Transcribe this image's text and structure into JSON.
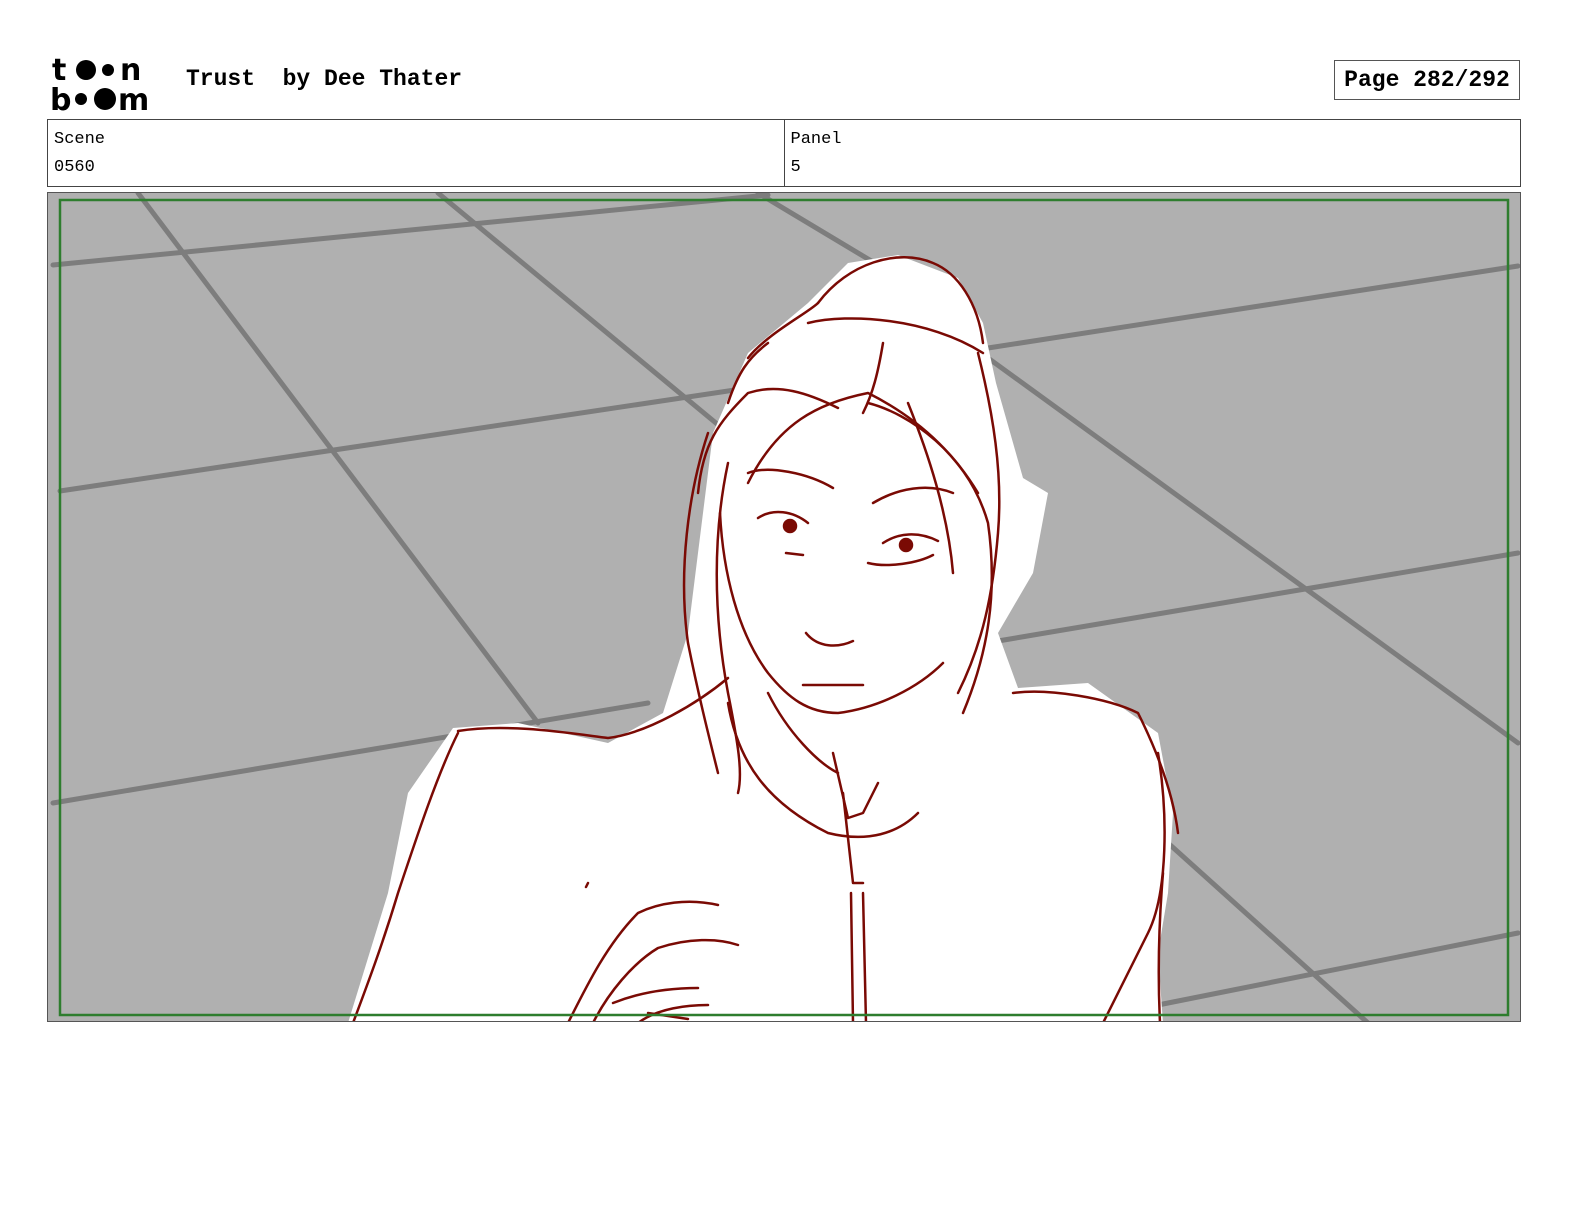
{
  "header": {
    "logo_text": "toon boom",
    "title": "Trust  by Dee Thater",
    "page_label": "Page 282/292"
  },
  "info": {
    "scene_label": "Scene",
    "scene_value": "0560",
    "panel_label": "Panel",
    "panel_value": "5"
  },
  "colors": {
    "background_gray": "#b0b0b0",
    "floor_lines": "#808080",
    "sketch_line": "#7a0a04",
    "safe_frame": "#2e7d2e"
  },
  "panel": {
    "image": "storyboard-sketch-character-on-tiled-floor"
  }
}
